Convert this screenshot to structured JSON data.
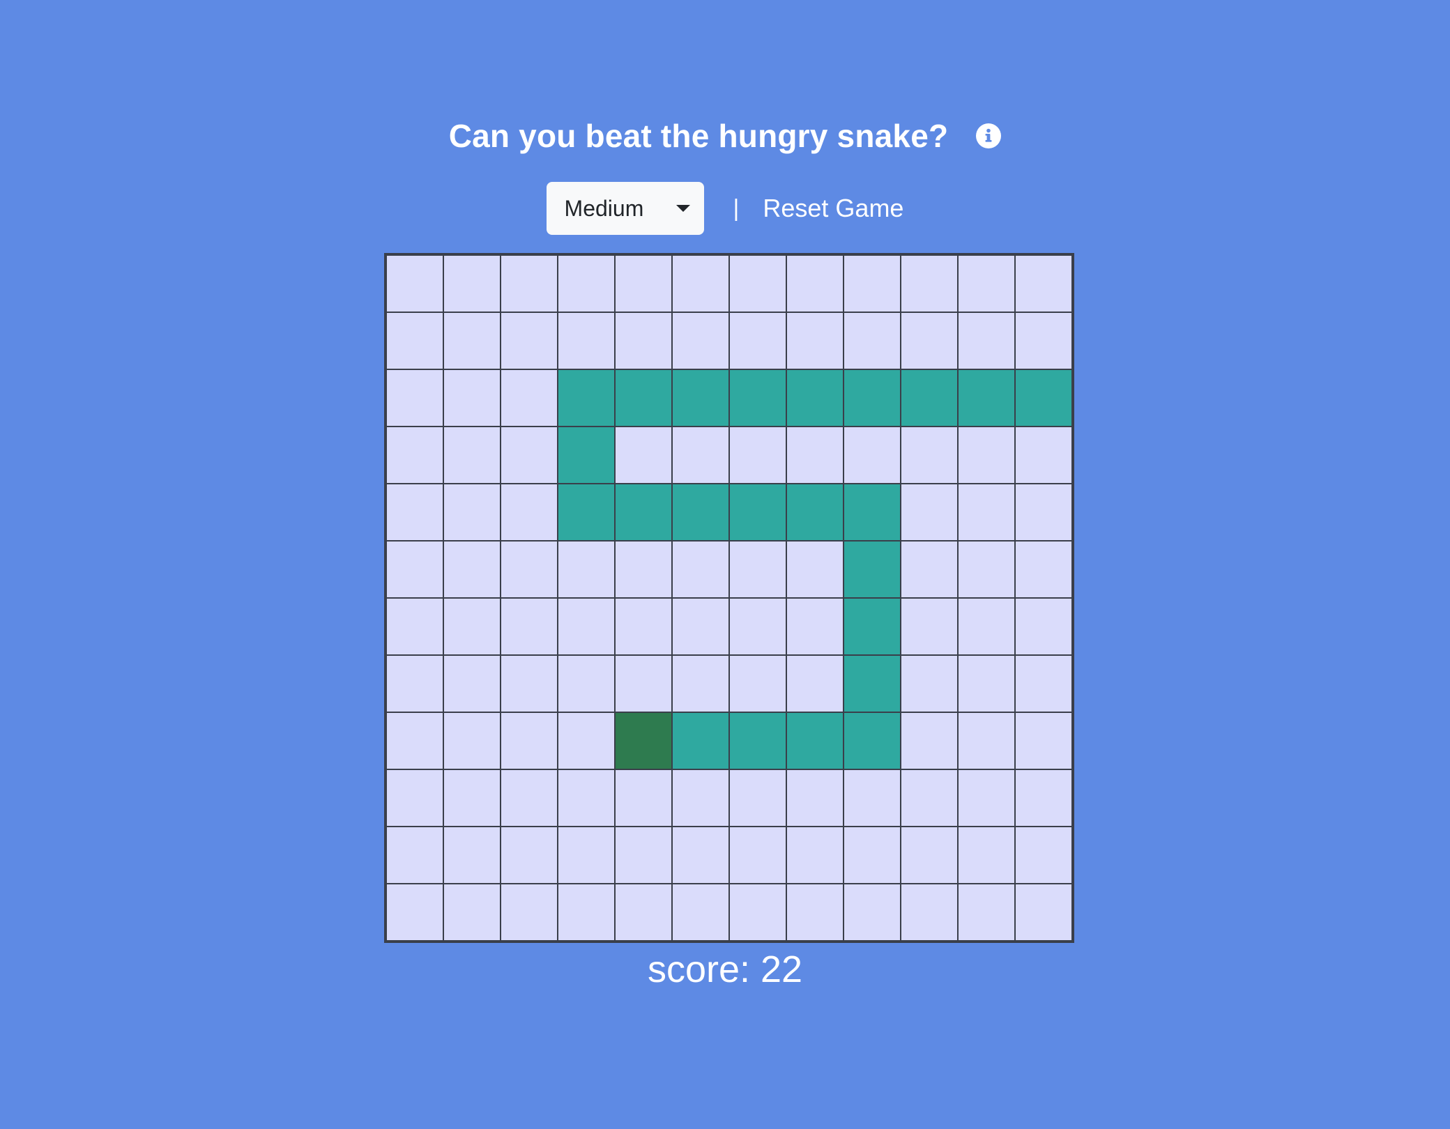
{
  "header": {
    "title": "Can you beat the hungry snake?",
    "info_icon": "info-icon"
  },
  "controls": {
    "difficulty_selected": "Medium",
    "divider": "|",
    "reset_label": "Reset Game"
  },
  "board": {
    "rows": 12,
    "cols": 12,
    "snake_body": [
      [
        2,
        3
      ],
      [
        2,
        4
      ],
      [
        2,
        5
      ],
      [
        2,
        6
      ],
      [
        2,
        7
      ],
      [
        2,
        8
      ],
      [
        2,
        9
      ],
      [
        2,
        10
      ],
      [
        2,
        11
      ],
      [
        3,
        3
      ],
      [
        4,
        3
      ],
      [
        4,
        4
      ],
      [
        4,
        5
      ],
      [
        4,
        6
      ],
      [
        4,
        7
      ],
      [
        4,
        8
      ],
      [
        5,
        8
      ],
      [
        6,
        8
      ],
      [
        7,
        8
      ],
      [
        8,
        5
      ],
      [
        8,
        6
      ],
      [
        8,
        7
      ],
      [
        8,
        8
      ]
    ],
    "snake_head": [
      8,
      4
    ],
    "colors": {
      "background": "#5e8ae4",
      "cell_empty": "#dadcfb",
      "snake_body": "#2fa9a0",
      "snake_head": "#2e7b4f",
      "grid_line": "#3a3f4a"
    }
  },
  "score": {
    "label": "score: 22"
  }
}
